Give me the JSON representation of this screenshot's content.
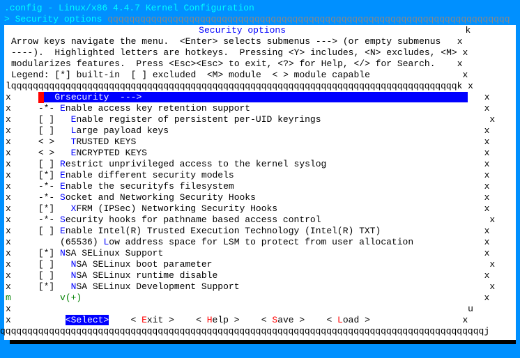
{
  "title": ".config - Linux/x86 4.4.7 Kernel Configuration",
  "breadcrumb_prefix": "> ",
  "breadcrumb": "Security options",
  "breadcrumb_fill": " qqqqqqqqqqqqqqqqqqqqqqqqqqqqqqqqqqqqqqqqqqqqqqqqqqqqqqqqqqqqqqqqqqqqqqqqqq",
  "panel_title": "Security options",
  "right_k": "k",
  "help_lines": [
    "Arrow keys navigate the menu.  <Enter> selects submenus ---> (or empty submenus   x",
    "----).  Highlighted letters are hotkeys.  Pressing <Y> includes, <N> excludes, <M> x",
    "modularizes features.  Press <Esc><Esc> to exit, <?> for Help, </> for Search.    x",
    "Legend: [*] built-in  [ ] excluded  <M> module  < > module capable                 x"
  ],
  "top_border": "lqqqqqqqqqqqqqqqqqqqqqqqqqqqqqqqqqqqqqqqqqqqqqqqqqqqqqqqqqqqqqqqqqqqqqqqqqqqqqqqqqqk x",
  "items": [
    {
      "left": "x",
      "bracket": "   ",
      "spacer": "  ",
      "selected": true,
      "hotkey": "G",
      "text": "rsecurity  --->"
    },
    {
      "left": "x",
      "bracket": "-*-",
      "spacer": " ",
      "hotkey": "E",
      "text": "nable access key retention support"
    },
    {
      "left": "x",
      "bracket": "[ ]",
      "spacer": "   ",
      "hotkey": "E",
      "text": "nable register of persistent per-UID keyrings"
    },
    {
      "left": "x",
      "bracket": "[ ]",
      "spacer": "   ",
      "hotkey": "L",
      "text": "arge payload keys"
    },
    {
      "left": "x",
      "bracket": "< >",
      "spacer": "   ",
      "hotkey": "T",
      "text": "RUSTED KEYS"
    },
    {
      "left": "x",
      "bracket": "< >",
      "spacer": "   ",
      "hotkey": "E",
      "text": "NCRYPTED KEYS"
    },
    {
      "left": "x",
      "bracket": "[ ]",
      "spacer": " ",
      "hotkey": "R",
      "text": "estrict unprivileged access to the kernel syslog"
    },
    {
      "left": "x",
      "bracket": "[*]",
      "spacer": " ",
      "hotkey": "E",
      "text": "nable different security models"
    },
    {
      "left": "x",
      "bracket": "-*-",
      "spacer": " ",
      "hotkey": "E",
      "text": "nable the securityfs filesystem"
    },
    {
      "left": "x",
      "bracket": "-*-",
      "spacer": " ",
      "hotkey": "S",
      "text": "ocket and Networking Security Hooks"
    },
    {
      "left": "x",
      "bracket": "[*]",
      "spacer": "   ",
      "hotkey": "X",
      "text": "FRM (IPSec) Networking Security Hooks"
    },
    {
      "left": "x",
      "bracket": "-*-",
      "spacer": " ",
      "hotkey": "S",
      "text": "ecurity hooks for pathname based access control"
    },
    {
      "left": "x",
      "bracket": "[ ]",
      "spacer": " ",
      "hotkey": "E",
      "text": "nable Intel(R) Trusted Execution Technology (Intel(R) TXT)"
    },
    {
      "left": "x",
      "bracket": "   ",
      "spacer": " ",
      "hotkey": "",
      "text": "(65536) ",
      "hotkey2": "L",
      "text2": "ow address space for LSM to protect from user allocation"
    },
    {
      "left": "x",
      "bracket": "[*]",
      "spacer": " ",
      "hotkey": "N",
      "text": "SA SELinux Support"
    },
    {
      "left": "x",
      "bracket": "[ ]",
      "spacer": "   ",
      "hotkey": "N",
      "text": "SA SELinux boot parameter"
    },
    {
      "left": "x",
      "bracket": "[ ]",
      "spacer": "   ",
      "hotkey": "N",
      "text": "SA SELinux runtime disable"
    },
    {
      "left": "x",
      "bracket": "[*]",
      "spacer": "   ",
      "hotkey": "N",
      "text": "SA SELinux Development Support"
    },
    {
      "left": "m",
      "bracket": "   ",
      "spacer": " ",
      "vplus": "v(+)"
    }
  ],
  "right_x": "x",
  "right_u": "u",
  "buttons": {
    "prefix": "x          ",
    "select": "<Select>",
    "exit_pre": "< ",
    "exit_hot": "E",
    "exit_post": "xit >",
    "help_pre": "< ",
    "help_hot": "H",
    "help_post": "elp >",
    "save_pre": "< ",
    "save_hot": "S",
    "save_post": "ave >",
    "load_pre": "< ",
    "load_hot": "L",
    "load_post": "oad >",
    "suffix": "                 x"
  },
  "bottom_border": "qqqqqqqqqqqqqqqqqqqqqqqqqqqqqqqqqqqqqqqqqqqqqqqqqqqqqqqqqqqqqqqqqqqqqqqqqqqqqqqqqqqqqqqqqj",
  "shadow": "                                                                                          "
}
